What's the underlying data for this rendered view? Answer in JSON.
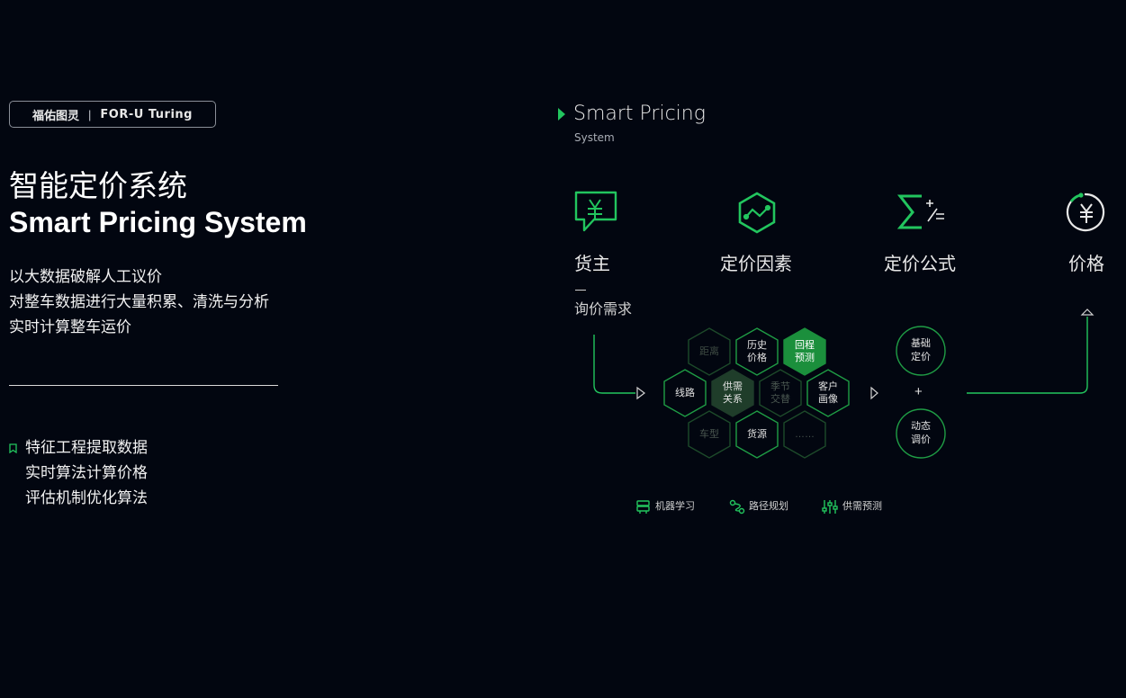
{
  "brand": {
    "cn": "福佑图灵",
    "separator": "|",
    "en": "FOR-U Turing"
  },
  "title_cn": "智能定价系统",
  "title_en": "Smart Pricing System",
  "description": [
    "以大数据破解人工议价",
    "对整车数据进行大量积累、清洗与分析",
    "实时计算整车运价"
  ],
  "features": [
    "特征工程提取数据",
    "实时算法计算价格",
    "评估机制优化算法"
  ],
  "diagram": {
    "title": "Smart Pricing",
    "subtitle": "System",
    "steps": [
      {
        "label": "货主",
        "icon": "yuan-chat-icon"
      },
      {
        "label": "定价因素",
        "icon": "hexagon-trend-icon"
      },
      {
        "label": "定价公式",
        "icon": "sigma-formula-icon"
      },
      {
        "label": "价格",
        "icon": "yuan-circle-icon"
      }
    ],
    "inquiry_label": "询价需求",
    "hexagons": [
      {
        "line1": "距离",
        "line2": "",
        "style": "dim"
      },
      {
        "line1": "历史",
        "line2": "价格",
        "style": "normal"
      },
      {
        "line1": "回程",
        "line2": "预测",
        "style": "filled"
      },
      {
        "line1": "线路",
        "line2": "",
        "style": "normal"
      },
      {
        "line1": "供需",
        "line2": "关系",
        "style": "dark-filled"
      },
      {
        "line1": "季节",
        "line2": "交替",
        "style": "dim"
      },
      {
        "line1": "客户",
        "line2": "画像",
        "style": "normal"
      },
      {
        "line1": "车型",
        "line2": "",
        "style": "dim"
      },
      {
        "line1": "货源",
        "line2": "",
        "style": "normal"
      },
      {
        "line1": "……",
        "line2": "",
        "style": "dim"
      }
    ],
    "base_price": {
      "line1": "基础",
      "line2": "定价"
    },
    "plus": "+",
    "dynamic_price": {
      "line1": "动态",
      "line2": "调价"
    },
    "legend": [
      {
        "label": "机器学习",
        "icon": "server-icon"
      },
      {
        "label": "路径规划",
        "icon": "route-icon"
      },
      {
        "label": "供需预测",
        "icon": "sliders-icon"
      }
    ]
  },
  "colors": {
    "background": "#020610",
    "accent": "#22c55e",
    "hex_border": "#1f9d45",
    "hex_dim": "#1d4a2a",
    "hex_fill": "#1b8f3c"
  }
}
